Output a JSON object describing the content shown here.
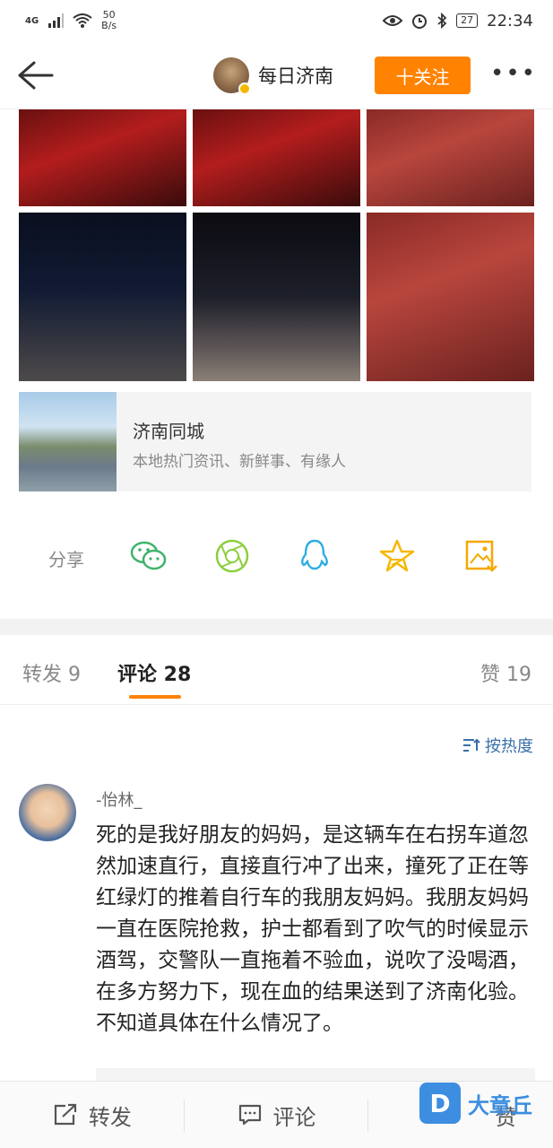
{
  "status": {
    "network": "4G",
    "speed_value": "50",
    "speed_unit": "B/s",
    "battery": "27",
    "time": "22:34"
  },
  "nav": {
    "title": "每日济南",
    "follow_label": "十关注",
    "more_label": "•••"
  },
  "card": {
    "title": "济南同城",
    "subtitle": "本地热门资讯、新鲜事、有缘人"
  },
  "share": {
    "label": "分享",
    "icons": [
      "wechat-icon",
      "moments-icon",
      "qq-icon",
      "qzone-star-icon",
      "save-image-icon"
    ]
  },
  "tabs": {
    "repost": "转发 9",
    "comments": "评论 28",
    "likes": "赞 19"
  },
  "sort_label": "按热度",
  "comment": {
    "username": "-怡林_",
    "text": "死的是我好朋友的妈妈，是这辆车在右拐车道忽然加速直行，直接直行冲了出来，撞死了正在等红绿灯的推着自行车的我朋友妈妈。我朋友妈妈一直在医院抢救，护士都看到了吹气的时候显示酒驾，交警队一直拖着不验血，说吹了没喝酒，在多方努力下，现在血的结果送到了济南化验。不知道具体在什么情况了。"
  },
  "bottom": {
    "repost": "转发",
    "comment": "评论",
    "like": "赞"
  },
  "watermark": {
    "logo": "D",
    "text": "大章丘"
  },
  "colors": {
    "accent": "#ff8200",
    "link": "#3a6fa8",
    "wechat": "#3fb36a",
    "moments": "#8ccf3f",
    "qq": "#2eaee0",
    "star": "#f5b800"
  }
}
